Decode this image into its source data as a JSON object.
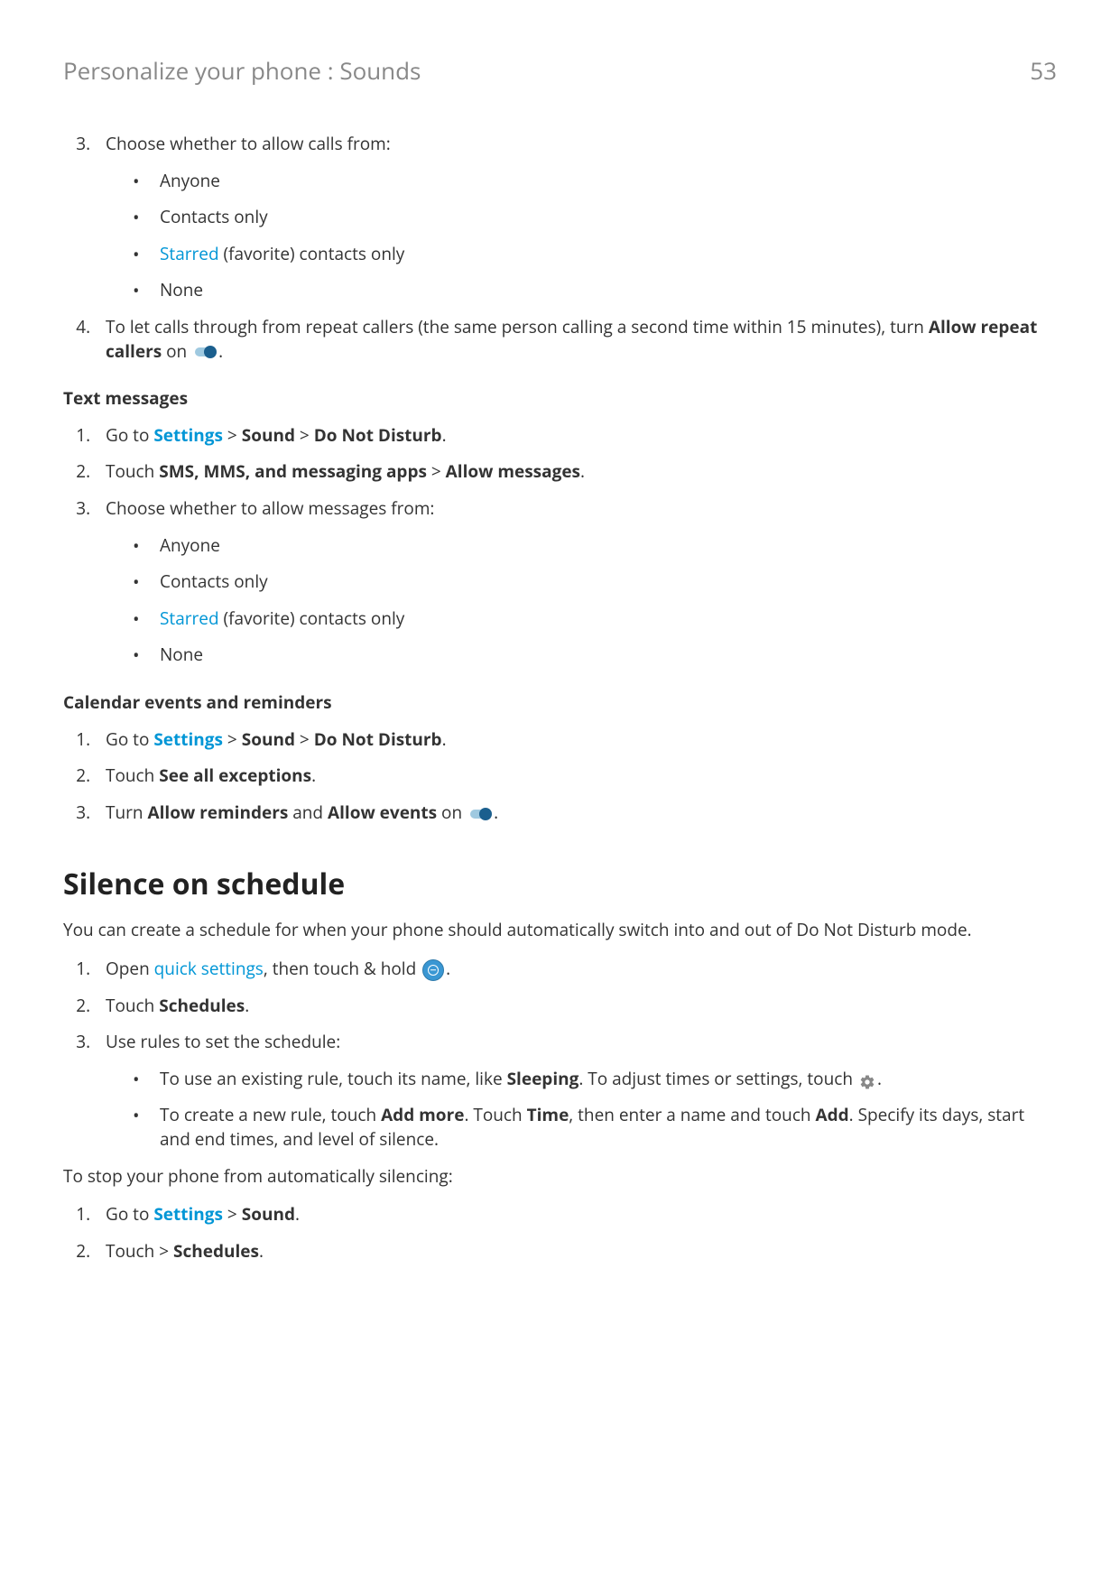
{
  "header": {
    "breadcrumb": "Personalize your phone : Sounds",
    "page": "53"
  },
  "s1": {
    "li3": "Choose whether to allow calls from:",
    "b1": "Anyone",
    "b2": "Contacts only",
    "b3_link": "Starred",
    "b3_rest": " (favorite) contacts only",
    "b4": "None",
    "li4a": "To let calls through from repeat callers (the same person calling a second time within 15 minutes), turn ",
    "li4b": "Allow repeat callers",
    "li4c": " on "
  },
  "text_messages": {
    "heading": "Text messages",
    "li1a": "Go to ",
    "li1_link": "Settings",
    "li1b": " > ",
    "li1c": "Sound",
    "li1d": " > ",
    "li1e": "Do Not Disturb",
    "li1f": ".",
    "li2a": "Touch ",
    "li2b": "SMS, MMS, and messaging apps",
    "li2c": " > ",
    "li2d": "Allow messages",
    "li2e": ".",
    "li3": "Choose whether to allow messages from:",
    "b1": "Anyone",
    "b2": "Contacts only",
    "b3_link": "Starred",
    "b3_rest": " (favorite) contacts only",
    "b4": "None"
  },
  "calendar": {
    "heading": "Calendar events and reminders",
    "li1a": "Go to ",
    "li1_link": "Settings",
    "li1b": " > ",
    "li1c": "Sound",
    "li1d": " > ",
    "li1e": "Do Not Disturb",
    "li1f": ".",
    "li2a": "Touch ",
    "li2b": "See all exceptions",
    "li2c": ".",
    "li3a": "Turn ",
    "li3b": "Allow reminders",
    "li3c": " and ",
    "li3d": "Allow events",
    "li3e": " on "
  },
  "silence": {
    "heading": "Silence on schedule",
    "intro": "You can create a schedule for when your phone should automatically switch into and out of Do Not Disturb mode.",
    "li1a": "Open ",
    "li1_link": "quick settings",
    "li1b": ", then touch & hold ",
    "li1c": ".",
    "li2a": "Touch ",
    "li2b": "Schedules",
    "li2c": ".",
    "li3": "Use rules to set the schedule:",
    "b1a": "To use an existing rule, touch its name, like ",
    "b1b": "Sleeping",
    "b1c": ". To adjust times or settings, touch ",
    "b1d": ".",
    "b2a": "To create a new rule, touch ",
    "b2b": "Add more",
    "b2c": ". Touch ",
    "b2d": "Time",
    "b2e": ", then enter a name and touch ",
    "b2f": "Add",
    "b2g": ". Specify its days, start and end times, and level of silence.",
    "stop": "To stop your phone from automatically silencing:",
    "s1a": "Go to ",
    "s1_link": "Settings",
    "s1b": " > ",
    "s1c": "Sound",
    "s1d": ".",
    "s2a": "Touch > ",
    "s2b": "Schedules",
    "s2c": "."
  }
}
